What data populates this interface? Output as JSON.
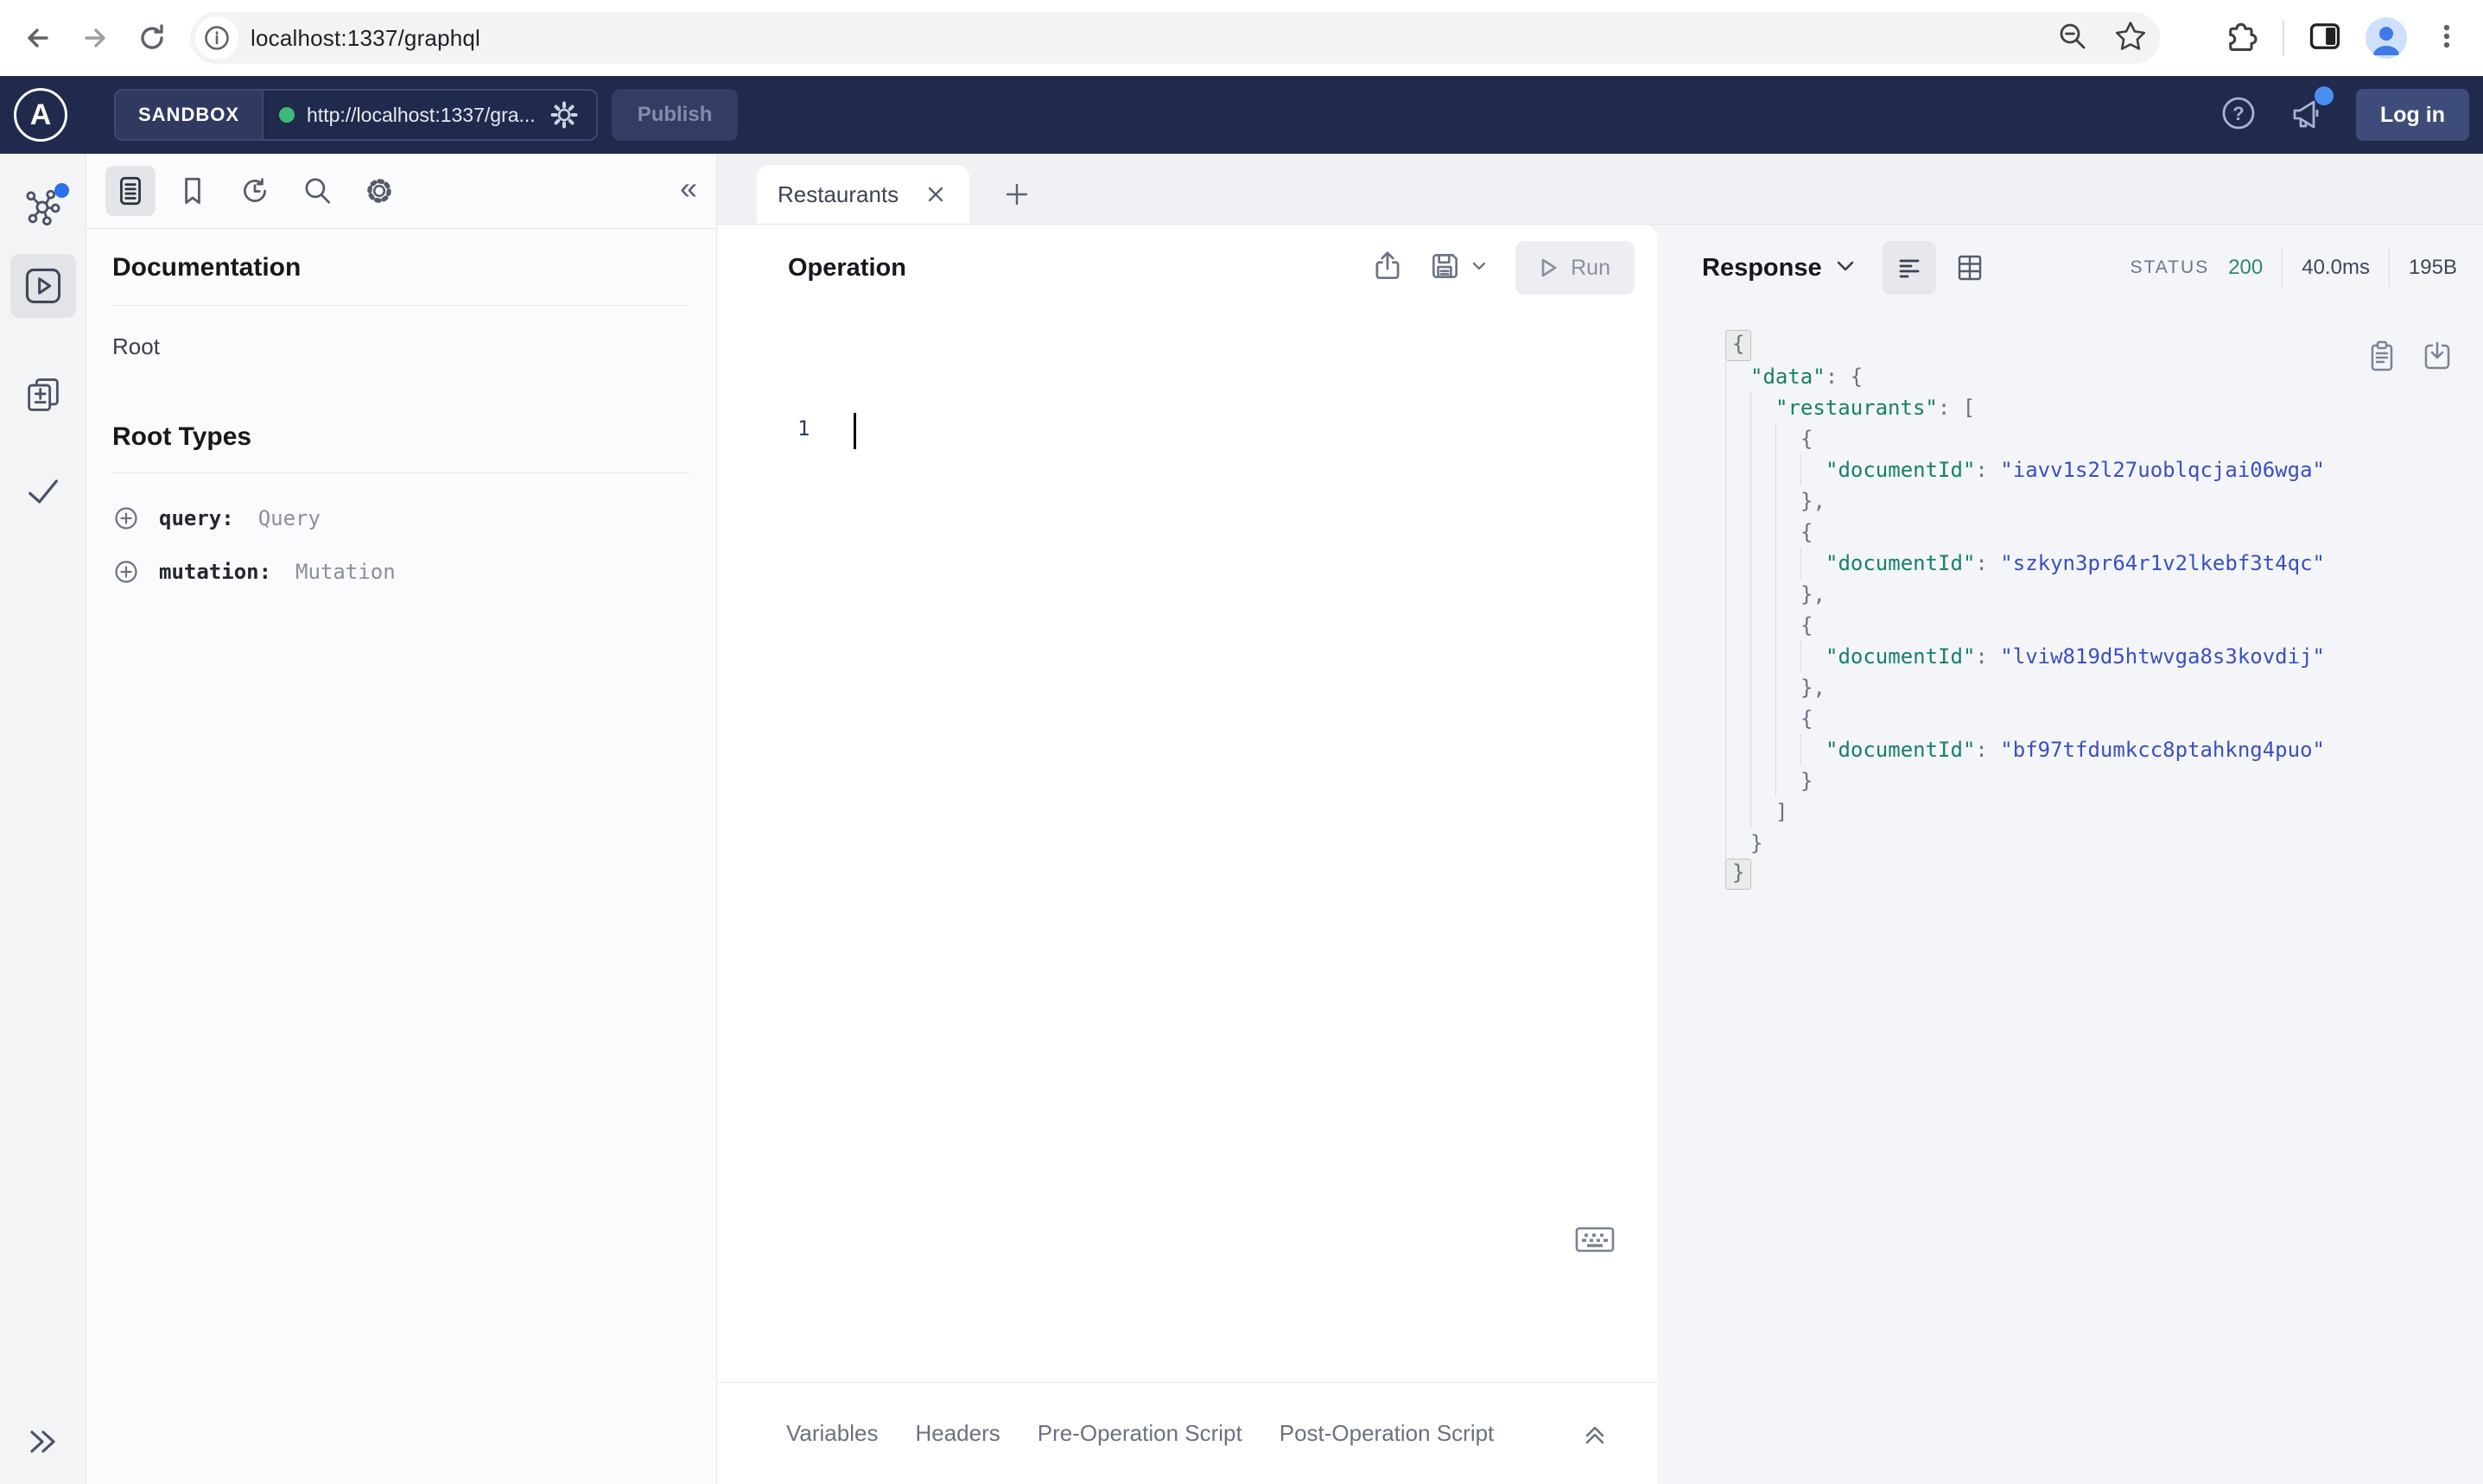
{
  "browser": {
    "url": "localhost:1337/graphql"
  },
  "header": {
    "badge": "SANDBOX",
    "endpoint": "http://localhost:1337/gra...",
    "publish_label": "Publish",
    "login_label": "Log in"
  },
  "docs": {
    "title": "Documentation",
    "root_label": "Root",
    "root_types_title": "Root Types",
    "fields": [
      {
        "name": "query:",
        "type": "Query"
      },
      {
        "name": "mutation:",
        "type": "Mutation"
      }
    ]
  },
  "tabs": {
    "active_label": "Restaurants"
  },
  "operation": {
    "title": "Operation",
    "run_label": "Run",
    "line_number": "1",
    "bottom_tabs": [
      "Variables",
      "Headers",
      "Pre-Operation Script",
      "Post-Operation Script"
    ]
  },
  "response": {
    "title": "Response",
    "status_label": "STATUS",
    "status_code": "200",
    "time": "40.0ms",
    "size": "195B",
    "data_key": "data",
    "collection_key": "restaurants",
    "field_key": "documentId",
    "document_ids": [
      "iavv1s2l27uoblqcjai06wga",
      "szkyn3pr64r1v2lkebf3t4qc",
      "lviw819d5htwvga8s3kovdij",
      "bf97tfdumkcc8ptahkng4puo"
    ]
  },
  "colors": {
    "header_bg": "#202a4d",
    "accent_blue": "#2f6fed",
    "status_green": "#2f8a67",
    "json_key": "#17806a",
    "json_string": "#3a50c2"
  }
}
